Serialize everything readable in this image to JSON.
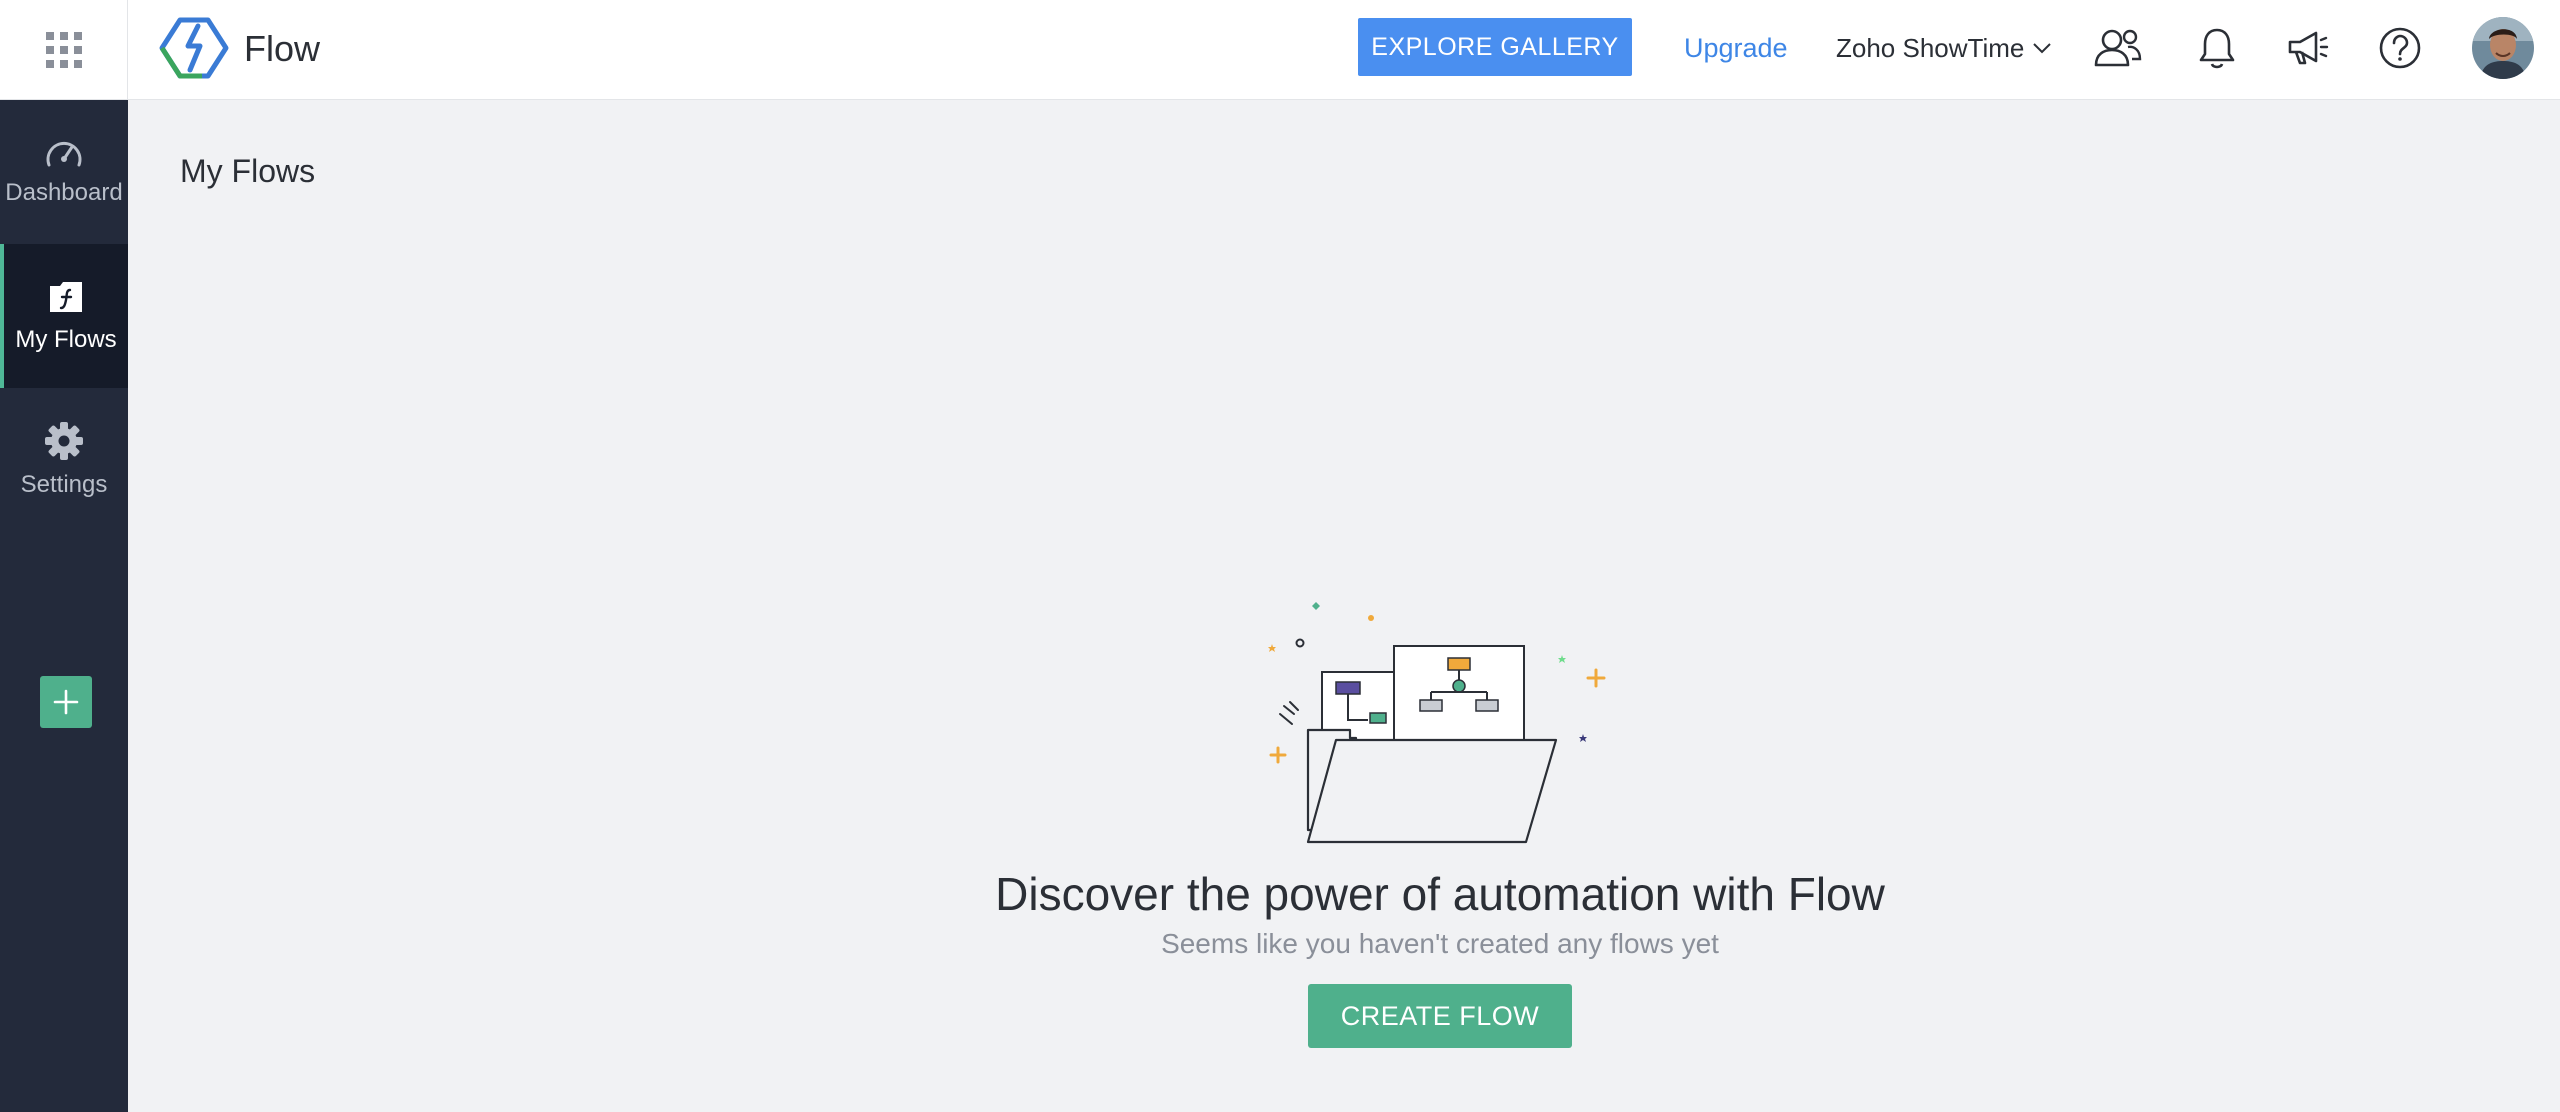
{
  "header": {
    "brand": "Flow",
    "explore_label": "EXPLORE GALLERY",
    "upgrade_label": "Upgrade",
    "org_name": "Zoho ShowTime",
    "icons": [
      "app-grid-icon",
      "flow-logo",
      "user-group-icon",
      "bell-icon",
      "megaphone-icon",
      "help-icon",
      "avatar"
    ]
  },
  "sidebar": {
    "items": [
      {
        "label": "Dashboard",
        "icon": "dashboard-icon"
      },
      {
        "label": "My Flows",
        "icon": "flows-icon",
        "active": true
      },
      {
        "label": "Settings",
        "icon": "gear-icon"
      }
    ],
    "add_icon": "plus-icon"
  },
  "main": {
    "title": "My Flows",
    "empty_state": {
      "heading": "Discover the power of automation with Flow",
      "subheading": "Seems like you haven't created any flows yet",
      "button_label": "CREATE FLOW"
    }
  },
  "colors": {
    "sidebar_bg": "#232a3b",
    "sidebar_active_bg": "#151b29",
    "accent_green": "#4fb08c",
    "explore_blue": "#4a8ff0",
    "link_blue": "#3e86e6",
    "page_bg": "#f1f2f4"
  }
}
